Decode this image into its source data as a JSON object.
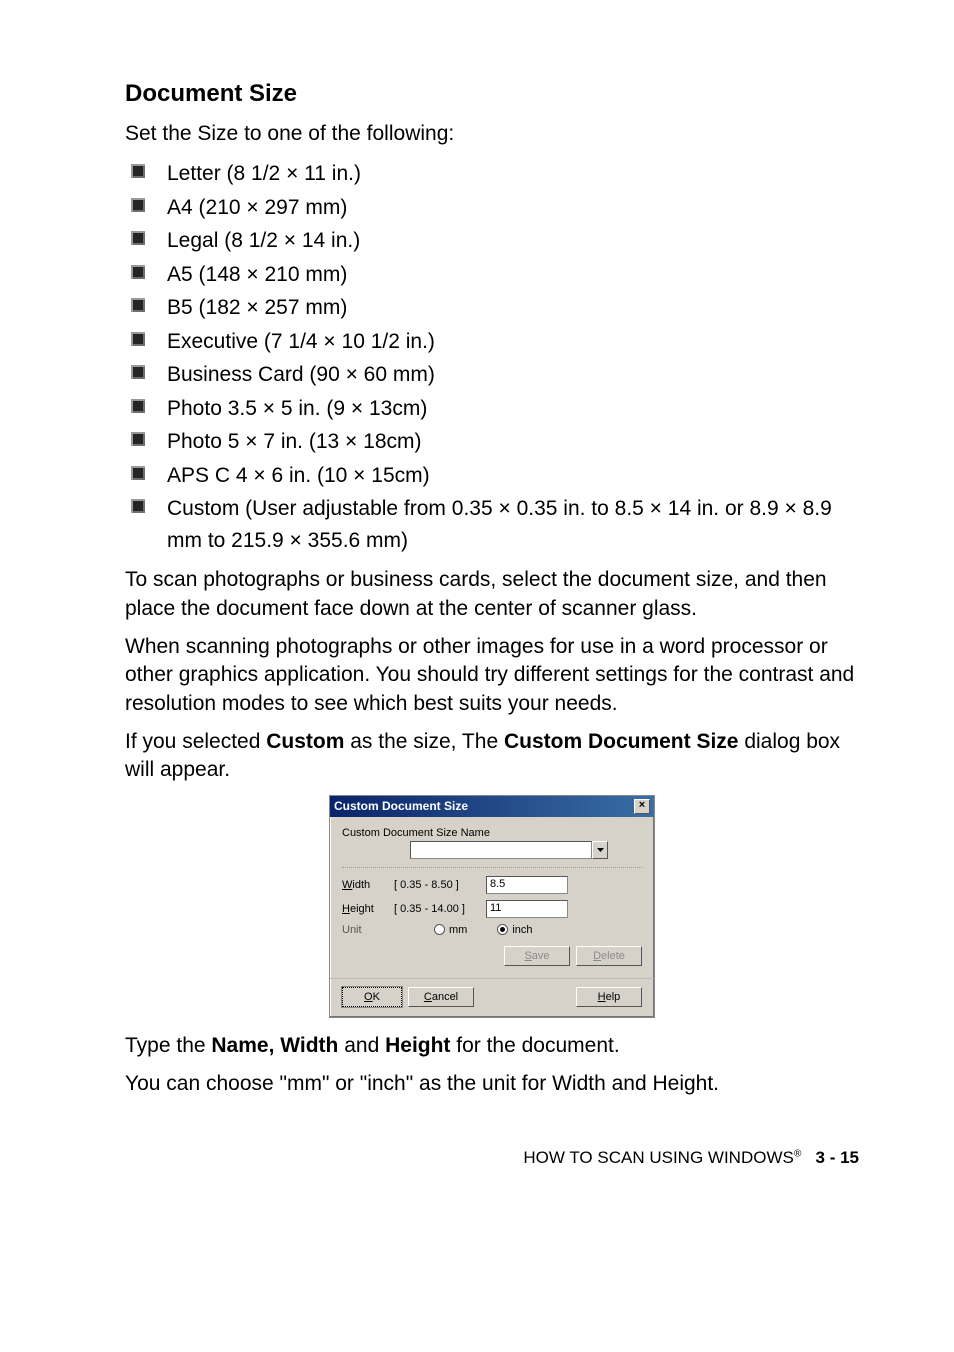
{
  "heading": "Document Size",
  "intro": "Set the Size to one of the following:",
  "sizes": [
    "Letter (8 1/2 × 11 in.)",
    "A4 (210 × 297 mm)",
    "Legal (8 1/2 × 14 in.)",
    "A5 (148 × 210 mm)",
    "B5 (182 × 257 mm)",
    "Executive (7 1/4 × 10 1/2 in.)",
    "Business Card (90 × 60 mm)",
    "Photo 3.5 × 5 in. (9 × 13cm)",
    "Photo 5 × 7 in. (13 × 18cm)",
    "APS C 4 × 6 in. (10 × 15cm)",
    "Custom (User adjustable from 0.35 × 0.35 in. to 8.5 × 14 in. or 8.9 × 8.9 mm to 215.9 × 355.6 mm)"
  ],
  "para1": "To scan photographs or business cards, select the document size, and then place the document face down at the center of scanner glass.",
  "para2": "When scanning photographs or other images for use in a word processor or other graphics application. You should try different settings for the contrast and resolution modes to see which best suits your needs.",
  "para3_pre": "If you selected ",
  "para3_b1": "Custom",
  "para3_mid": " as the size, The ",
  "para3_b2": "Custom Document Size",
  "para3_post": " dialog box will appear.",
  "dialog": {
    "title": "Custom Document Size",
    "name_label": "Custom Document Size Name",
    "width_label_u": "W",
    "width_label_rest": "idth",
    "width_range": "[ 0.35 -   8.50 ]",
    "width_value": "8.5",
    "height_label_u": "H",
    "height_label_rest": "eight",
    "height_range": "[ 0.35 - 14.00 ]",
    "height_value": "11",
    "unit_label": "Unit",
    "unit_mm_u": "m",
    "unit_mm_rest": "m",
    "unit_inch_u": "i",
    "unit_inch_rest": "nch",
    "save_u": "S",
    "save_rest": "ave",
    "delete_u": "D",
    "delete_rest": "elete",
    "ok_u": "O",
    "ok_rest": "K",
    "cancel_u": "C",
    "cancel_rest": "ancel",
    "help_u": "H",
    "help_rest": "elp"
  },
  "para4_pre": "Type the ",
  "para4_b": "Name, Width",
  "para4_mid": " and ",
  "para4_b2": "Height",
  "para4_post": " for the document.",
  "para5": "You can choose \"mm\" or \"inch\" as the unit for Width and Height.",
  "footer_text": "HOW TO SCAN USING WINDOWS",
  "footer_page": "3 - 15"
}
